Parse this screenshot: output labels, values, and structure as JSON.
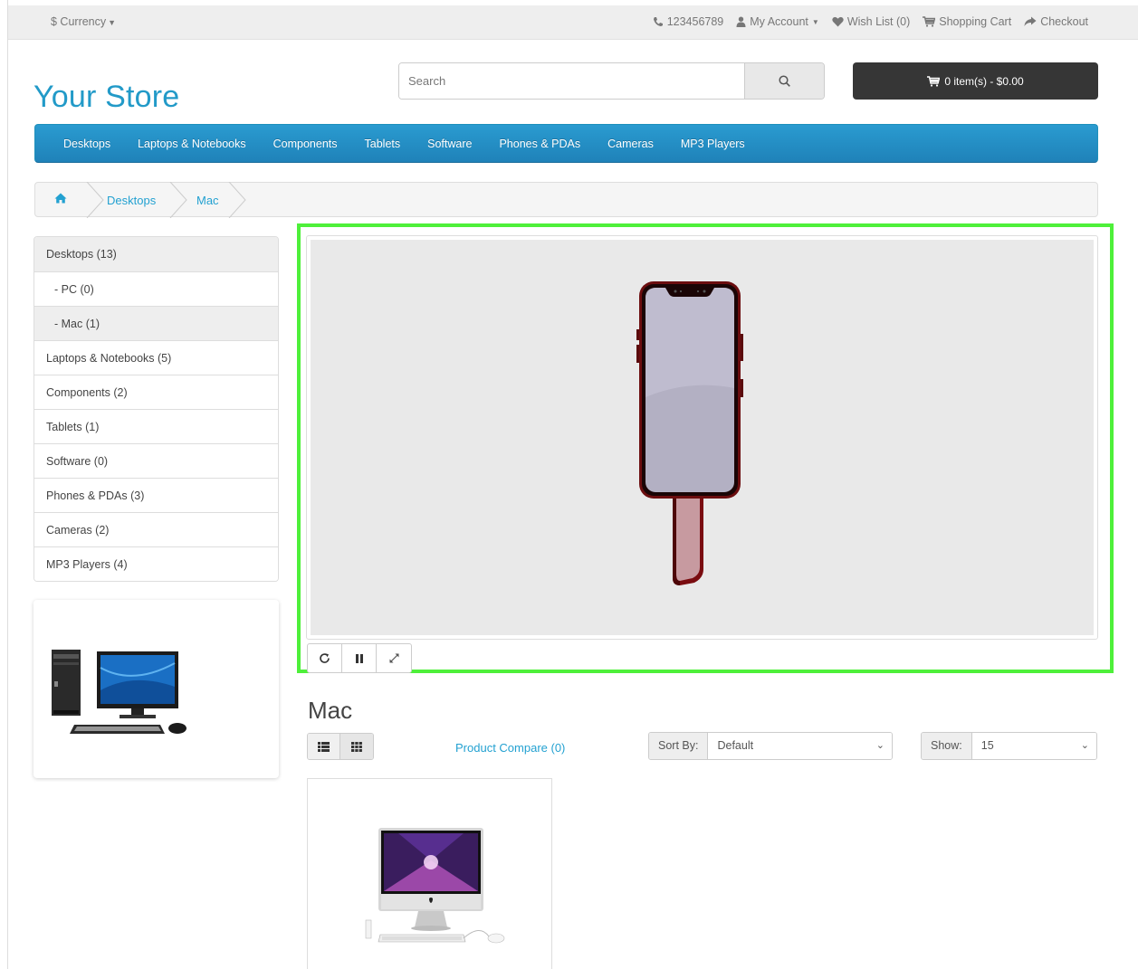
{
  "topbar": {
    "currency_label": "$ Currency",
    "phone": "123456789",
    "my_account": "My Account",
    "wishlist": "Wish List (0)",
    "shopping_cart": "Shopping Cart",
    "checkout": "Checkout"
  },
  "header": {
    "logo": "Your Store",
    "search_placeholder": "Search",
    "cart_label": "0 item(s) - $0.00"
  },
  "menu": {
    "items": [
      "Desktops",
      "Laptops & Notebooks",
      "Components",
      "Tablets",
      "Software",
      "Phones & PDAs",
      "Cameras",
      "MP3 Players"
    ]
  },
  "breadcrumb": {
    "items": [
      "Desktops",
      "Mac"
    ]
  },
  "sidebar": {
    "categories": [
      {
        "label": "Desktops (13)",
        "active": true,
        "sub": false
      },
      {
        "label": "- PC (0)",
        "active": false,
        "sub": true
      },
      {
        "label": "- Mac (1)",
        "active": true,
        "sub": true
      },
      {
        "label": "Laptops & Notebooks (5)",
        "active": false,
        "sub": false
      },
      {
        "label": "Components (2)",
        "active": false,
        "sub": false
      },
      {
        "label": "Tablets (1)",
        "active": false,
        "sub": false
      },
      {
        "label": "Software (0)",
        "active": false,
        "sub": false
      },
      {
        "label": "Phones & PDAs (3)",
        "active": false,
        "sub": false
      },
      {
        "label": "Cameras (2)",
        "active": false,
        "sub": false
      },
      {
        "label": "MP3 Players (4)",
        "active": false,
        "sub": false
      }
    ]
  },
  "viewer": {
    "controls": [
      "reload-icon",
      "pause-icon",
      "fullscreen-icon"
    ],
    "highlight_color": "#4ef03a"
  },
  "category": {
    "title": "Mac",
    "product_compare": "Product Compare (0)",
    "sort_label": "Sort By:",
    "sort_value": "Default",
    "show_label": "Show:",
    "show_value": "15"
  },
  "colors": {
    "accent": "#229ac8",
    "menu": "#2a9bd0",
    "cart_button": "#363636"
  }
}
